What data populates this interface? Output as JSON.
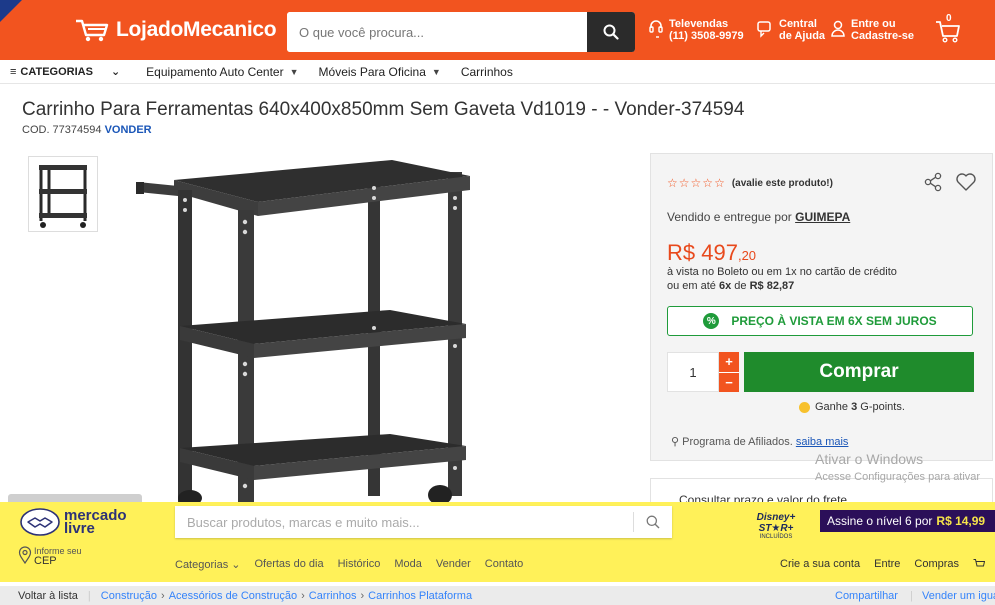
{
  "header": {
    "logo_text": "LojadoMecanico",
    "search_placeholder": "O que você procura...",
    "televendas_label": "Televendas",
    "televendas_phone": "(11) 3508-9979",
    "central_label": "Central",
    "central_sub": "de Ajuda",
    "login_label": "Entre ou",
    "login_sub": "Cadastre-se",
    "cart_count": "0",
    "accent_color": "#f2541f"
  },
  "nav": {
    "categories": "CATEGORIAS",
    "items": [
      "Equipamento Auto Center",
      "Móveis Para Oficina",
      "Carrinhos"
    ]
  },
  "product": {
    "title": "Carrinho Para Ferramentas 640x400x850mm Sem Gaveta Vd1019 - - Vonder-374594",
    "code_label": "COD. 77374594",
    "brand": "VONDER"
  },
  "buybox": {
    "rate_label": "(avalie este produto!)",
    "rating_stars": 0,
    "sold_by": "Vendido e entregue por",
    "seller": "GUIMEPA",
    "price_main": "R$ 497",
    "price_cents": ",20",
    "pay_line1": "à vista no Boleto ou em 1x no cartão de crédito",
    "pay_line2_pre": "ou em até",
    "pay_installments": "6x",
    "pay_line2_mid": "de",
    "pay_installment_value": "R$ 82,87",
    "promo_text": "PREÇO À VISTA EM 6X SEM JUROS",
    "qty": "1",
    "buy_label": "Comprar",
    "points_pre": "Ganhe",
    "points_value": "3",
    "points_post": "G-points.",
    "affiliate_text": "Programa de Afiliados.",
    "affiliate_link": "saiba mais",
    "cep_peek": "Consultar prazo e valor do frete"
  },
  "watermark": {
    "line1": "Ativar o Windows",
    "line2": "Acesse Configurações para ativar"
  },
  "mercadolivre": {
    "logo_line1": "mercado",
    "logo_line2": "livre",
    "search_placeholder": "Buscar produtos, marcas e muito mais...",
    "disney_top": "Disney+ ST★R+",
    "disney_bottom": "INCLUÍDOS",
    "promo_text": "Assine o nível 6 por",
    "promo_price": "R$ 14,99",
    "cep_label": "Informe seu",
    "cep_value": "CEP",
    "links": [
      "Categorias ⌄",
      "Ofertas do dia",
      "Histórico",
      "Moda",
      "Vender",
      "Contato"
    ],
    "right_links": [
      "Crie a sua conta",
      "Entre",
      "Compras"
    ]
  },
  "breadcrumb": {
    "back": "Voltar à lista",
    "crumbs": [
      "Construção",
      "Acessórios de Construção",
      "Carrinhos",
      "Carrinhos Plataforma"
    ],
    "share": "Compartilhar",
    "sell": "Vender um igual"
  }
}
